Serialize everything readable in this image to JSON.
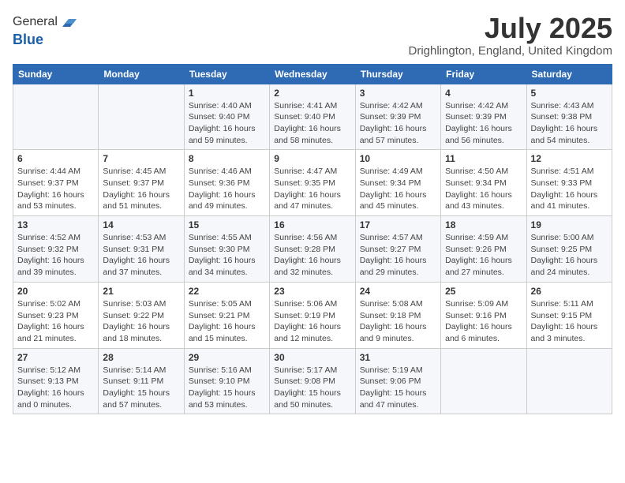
{
  "logo": {
    "line1": "General",
    "line2": "Blue"
  },
  "title": "July 2025",
  "location": "Drighlington, England, United Kingdom",
  "days_of_week": [
    "Sunday",
    "Monday",
    "Tuesday",
    "Wednesday",
    "Thursday",
    "Friday",
    "Saturday"
  ],
  "weeks": [
    [
      {
        "day": "",
        "info": ""
      },
      {
        "day": "",
        "info": ""
      },
      {
        "day": "1",
        "info": "Sunrise: 4:40 AM\nSunset: 9:40 PM\nDaylight: 16 hours and 59 minutes."
      },
      {
        "day": "2",
        "info": "Sunrise: 4:41 AM\nSunset: 9:40 PM\nDaylight: 16 hours and 58 minutes."
      },
      {
        "day": "3",
        "info": "Sunrise: 4:42 AM\nSunset: 9:39 PM\nDaylight: 16 hours and 57 minutes."
      },
      {
        "day": "4",
        "info": "Sunrise: 4:42 AM\nSunset: 9:39 PM\nDaylight: 16 hours and 56 minutes."
      },
      {
        "day": "5",
        "info": "Sunrise: 4:43 AM\nSunset: 9:38 PM\nDaylight: 16 hours and 54 minutes."
      }
    ],
    [
      {
        "day": "6",
        "info": "Sunrise: 4:44 AM\nSunset: 9:37 PM\nDaylight: 16 hours and 53 minutes."
      },
      {
        "day": "7",
        "info": "Sunrise: 4:45 AM\nSunset: 9:37 PM\nDaylight: 16 hours and 51 minutes."
      },
      {
        "day": "8",
        "info": "Sunrise: 4:46 AM\nSunset: 9:36 PM\nDaylight: 16 hours and 49 minutes."
      },
      {
        "day": "9",
        "info": "Sunrise: 4:47 AM\nSunset: 9:35 PM\nDaylight: 16 hours and 47 minutes."
      },
      {
        "day": "10",
        "info": "Sunrise: 4:49 AM\nSunset: 9:34 PM\nDaylight: 16 hours and 45 minutes."
      },
      {
        "day": "11",
        "info": "Sunrise: 4:50 AM\nSunset: 9:34 PM\nDaylight: 16 hours and 43 minutes."
      },
      {
        "day": "12",
        "info": "Sunrise: 4:51 AM\nSunset: 9:33 PM\nDaylight: 16 hours and 41 minutes."
      }
    ],
    [
      {
        "day": "13",
        "info": "Sunrise: 4:52 AM\nSunset: 9:32 PM\nDaylight: 16 hours and 39 minutes."
      },
      {
        "day": "14",
        "info": "Sunrise: 4:53 AM\nSunset: 9:31 PM\nDaylight: 16 hours and 37 minutes."
      },
      {
        "day": "15",
        "info": "Sunrise: 4:55 AM\nSunset: 9:30 PM\nDaylight: 16 hours and 34 minutes."
      },
      {
        "day": "16",
        "info": "Sunrise: 4:56 AM\nSunset: 9:28 PM\nDaylight: 16 hours and 32 minutes."
      },
      {
        "day": "17",
        "info": "Sunrise: 4:57 AM\nSunset: 9:27 PM\nDaylight: 16 hours and 29 minutes."
      },
      {
        "day": "18",
        "info": "Sunrise: 4:59 AM\nSunset: 9:26 PM\nDaylight: 16 hours and 27 minutes."
      },
      {
        "day": "19",
        "info": "Sunrise: 5:00 AM\nSunset: 9:25 PM\nDaylight: 16 hours and 24 minutes."
      }
    ],
    [
      {
        "day": "20",
        "info": "Sunrise: 5:02 AM\nSunset: 9:23 PM\nDaylight: 16 hours and 21 minutes."
      },
      {
        "day": "21",
        "info": "Sunrise: 5:03 AM\nSunset: 9:22 PM\nDaylight: 16 hours and 18 minutes."
      },
      {
        "day": "22",
        "info": "Sunrise: 5:05 AM\nSunset: 9:21 PM\nDaylight: 16 hours and 15 minutes."
      },
      {
        "day": "23",
        "info": "Sunrise: 5:06 AM\nSunset: 9:19 PM\nDaylight: 16 hours and 12 minutes."
      },
      {
        "day": "24",
        "info": "Sunrise: 5:08 AM\nSunset: 9:18 PM\nDaylight: 16 hours and 9 minutes."
      },
      {
        "day": "25",
        "info": "Sunrise: 5:09 AM\nSunset: 9:16 PM\nDaylight: 16 hours and 6 minutes."
      },
      {
        "day": "26",
        "info": "Sunrise: 5:11 AM\nSunset: 9:15 PM\nDaylight: 16 hours and 3 minutes."
      }
    ],
    [
      {
        "day": "27",
        "info": "Sunrise: 5:12 AM\nSunset: 9:13 PM\nDaylight: 16 hours and 0 minutes."
      },
      {
        "day": "28",
        "info": "Sunrise: 5:14 AM\nSunset: 9:11 PM\nDaylight: 15 hours and 57 minutes."
      },
      {
        "day": "29",
        "info": "Sunrise: 5:16 AM\nSunset: 9:10 PM\nDaylight: 15 hours and 53 minutes."
      },
      {
        "day": "30",
        "info": "Sunrise: 5:17 AM\nSunset: 9:08 PM\nDaylight: 15 hours and 50 minutes."
      },
      {
        "day": "31",
        "info": "Sunrise: 5:19 AM\nSunset: 9:06 PM\nDaylight: 15 hours and 47 minutes."
      },
      {
        "day": "",
        "info": ""
      },
      {
        "day": "",
        "info": ""
      }
    ]
  ]
}
